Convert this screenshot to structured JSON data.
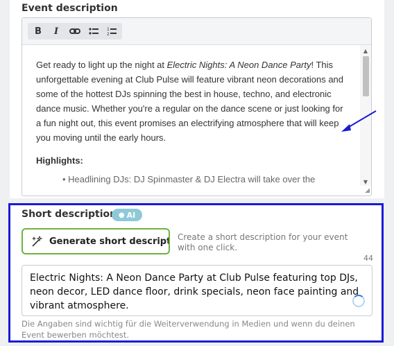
{
  "event_description": {
    "label": "Event description",
    "toolbar": {
      "bold": "B",
      "italic": "I",
      "link_icon": "link-icon",
      "bullet_list_icon": "bullet-list-icon",
      "numbered_list_icon": "numbered-list-icon"
    },
    "content": {
      "p1_before": "Get ready to light up the night at ",
      "p1_italic": "Electric Nights: A Neon Dance Party",
      "p1_after": "! This unforgettable evening at Club Pulse will feature vibrant neon decorations and some of the hottest DJs spinning the best in house, techno, and electronic dance music. Whether you're a regular on the dance scene or just looking for a fun night out, this event promises an electrifying atmosphere that will keep you moving until the early hours.",
      "highlights_heading": "Highlights:",
      "bullet_partial": "•  Headlining DJs: DJ Spinmaster & DJ Electra will take over the"
    }
  },
  "short_description": {
    "label": "Short description*",
    "ai_badge": "AI",
    "generate_button": "Generate short description",
    "generate_hint": "Create a short description for your event with one click.",
    "char_count": "44",
    "value": "Electric Nights: A Neon Dance Party at Club Pulse featuring top DJs, neon decor, LED dance floor, drink specials, neon face painting and vibrant atmosphere.",
    "help_text": "Die Angaben sind wichtig für die Weiterverwendung in Medien und wenn du deinen Event bewerben möchtest."
  },
  "colors": {
    "highlight_border": "#1a1ad6",
    "generate_border": "#6db33f",
    "ai_badge": "#8ec9d8",
    "annotation_arrow": "#1a1ad6"
  }
}
